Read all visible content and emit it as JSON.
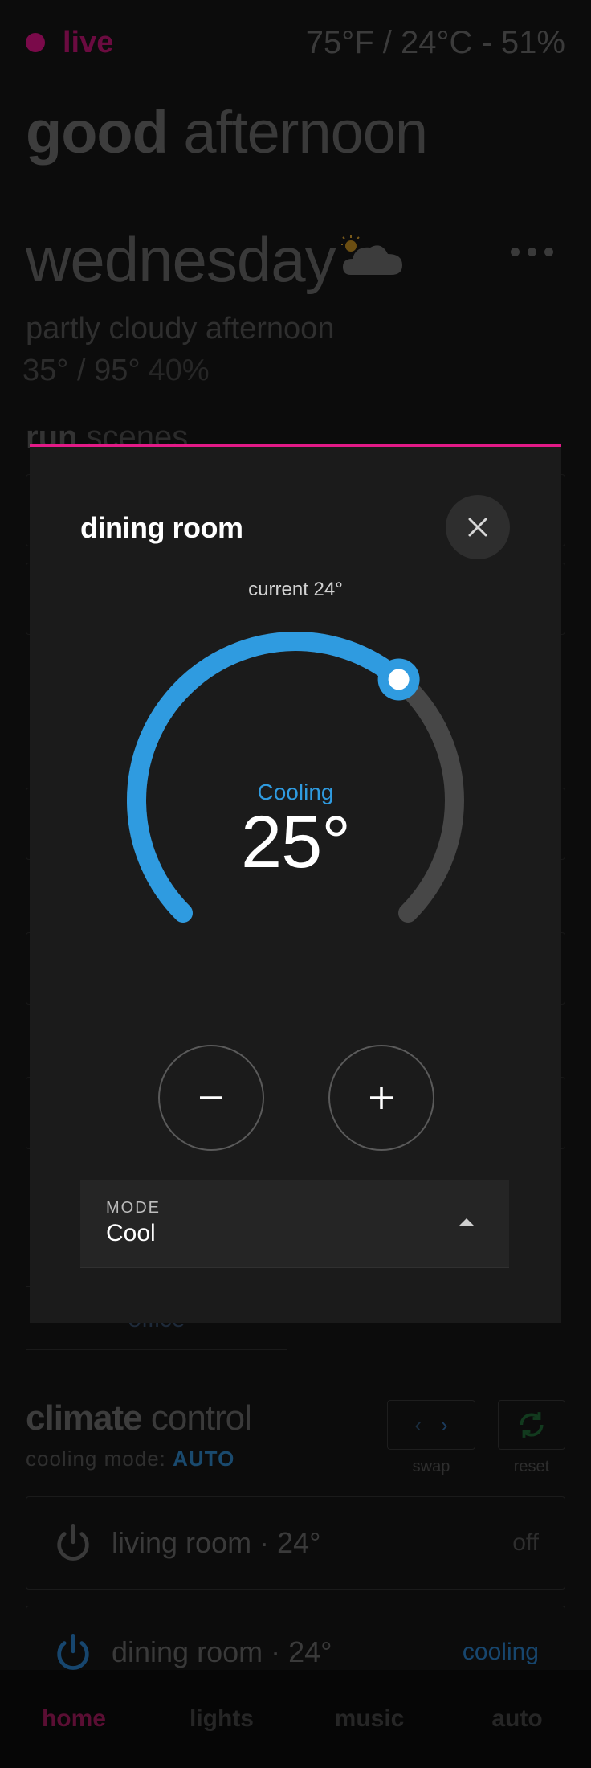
{
  "status": {
    "live_label": "live",
    "weather_summary": "75°F / 24°C - 51%"
  },
  "greeting": {
    "bold": "good",
    "rest": " afternoon"
  },
  "weather": {
    "weekday": "wednesday",
    "icon": "partly-cloudy-icon",
    "forecast": "partly cloudy afternoon",
    "temps": "35° / 95°",
    "humidity": "40%"
  },
  "scenes": {
    "title_bold": "run",
    "title_rest": " scenes",
    "office_label": "office"
  },
  "climate": {
    "title_bold": "climate",
    "title_rest": " control",
    "mode_prefix": "cooling mode: ",
    "mode_value": "AUTO",
    "swap_label": "swap",
    "reset_label": "reset",
    "rows": [
      {
        "name": "living room · 24°",
        "state": "off"
      },
      {
        "name": "dining room · 24°",
        "state": "cooling"
      }
    ]
  },
  "nav": {
    "items": [
      "home",
      "lights",
      "music",
      "auto"
    ],
    "active": "home"
  },
  "modal": {
    "title": "dining room",
    "current": "current 24°",
    "mode_label": "Cooling",
    "target": "25°",
    "dial_fraction": 0.65,
    "mode_caption": "MODE",
    "mode_value": "Cool",
    "colors": {
      "accent": "#e31a87",
      "active_arc": "#2f9be0",
      "inactive_arc": "#474747"
    }
  }
}
